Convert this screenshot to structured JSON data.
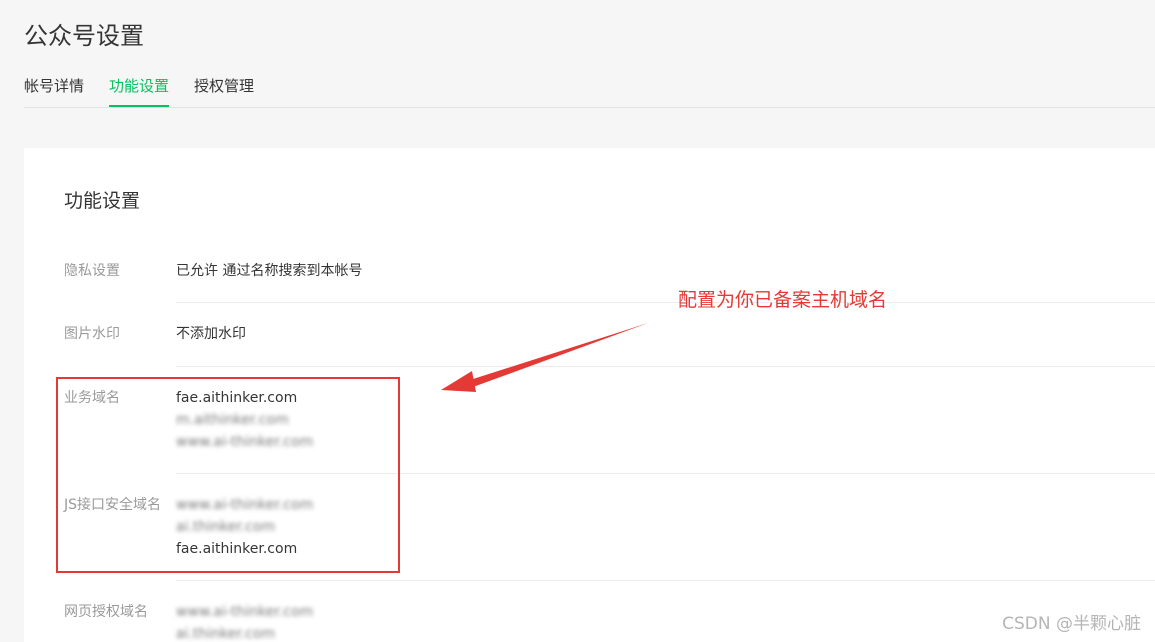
{
  "page": {
    "title": "公众号设置"
  },
  "tabs": [
    {
      "label": "帐号详情",
      "active": false
    },
    {
      "label": "功能设置",
      "active": true
    },
    {
      "label": "授权管理",
      "active": false
    }
  ],
  "card": {
    "title": "功能设置",
    "rows": {
      "privacy": {
        "label": "隐私设置",
        "value": "已允许 通过名称搜索到本帐号"
      },
      "watermark": {
        "label": "图片水印",
        "value": "不添加水印"
      },
      "business_domain": {
        "label": "业务域名",
        "values": [
          "fae.aithinker.com",
          "m.aithinker.com",
          "www.ai-thinker.com"
        ]
      },
      "js_domain": {
        "label": "JS接口安全域名",
        "values": [
          "www.ai-thinker.com",
          "ai.thinker.com",
          "fae.aithinker.com"
        ]
      },
      "oauth_domain": {
        "label": "网页授权域名",
        "values": [
          "www.ai-thinker.com",
          "ai.thinker.com"
        ]
      }
    }
  },
  "annotation": {
    "text": "配置为你已备案主机域名",
    "color": "#e53935"
  },
  "watermark": {
    "text": "CSDN @半颗心脏"
  },
  "colors": {
    "accent": "#07c160",
    "annotation_red": "#e53935"
  }
}
